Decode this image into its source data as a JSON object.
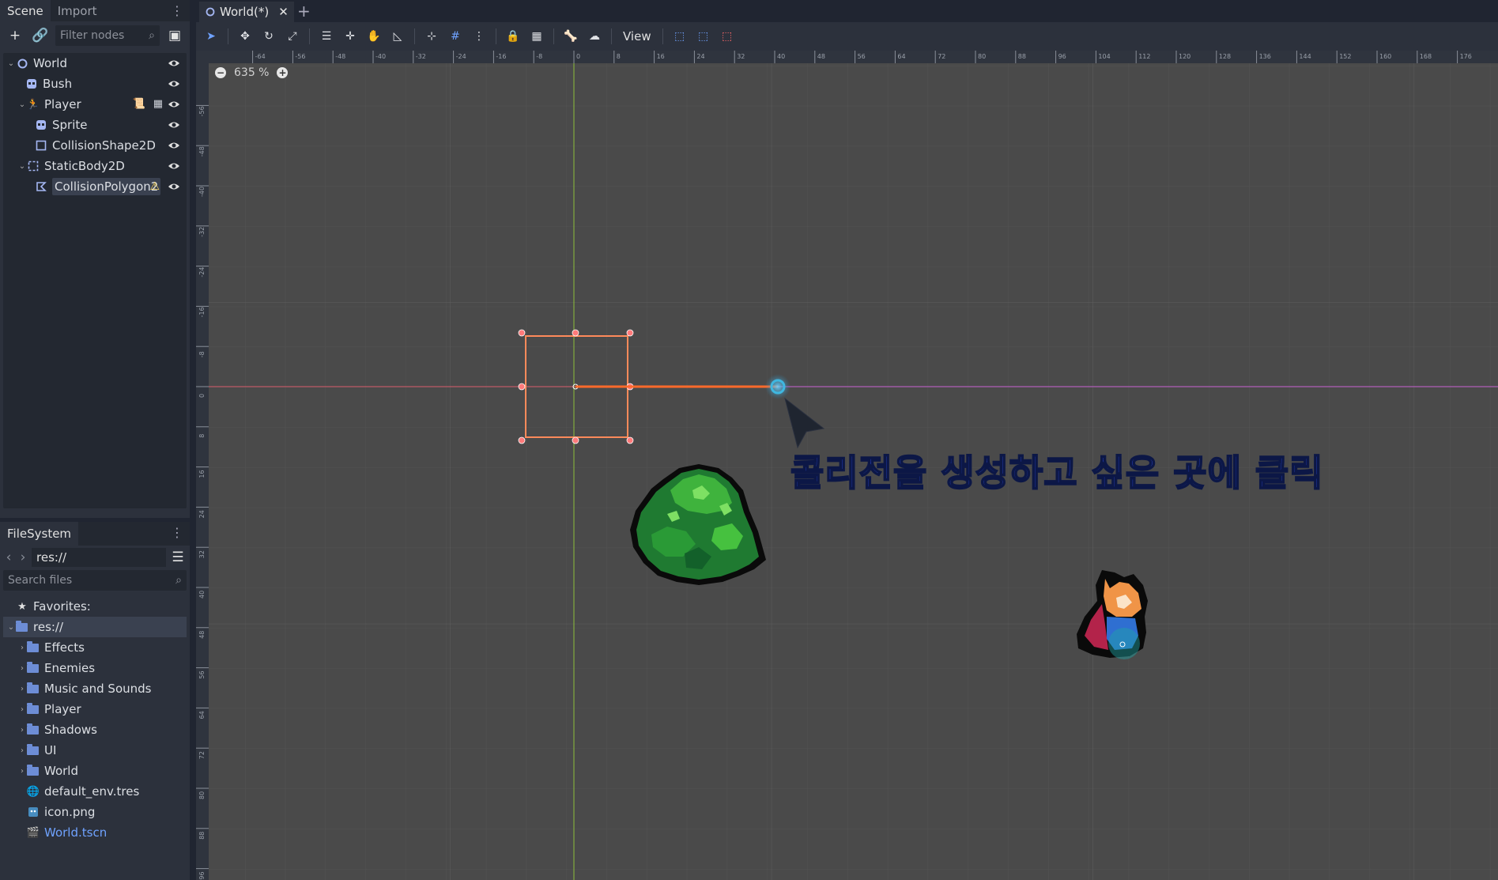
{
  "scene_dock": {
    "tabs": [
      "Scene",
      "Import"
    ],
    "filter_placeholder": "Filter nodes",
    "nodes": [
      {
        "label": "World",
        "icon": "node2d-icon"
      },
      {
        "label": "Bush",
        "icon": "sprite-icon"
      },
      {
        "label": "Player",
        "icon": "kinematic-body-icon"
      },
      {
        "label": "Sprite",
        "icon": "sprite-icon"
      },
      {
        "label": "CollisionShape2D",
        "icon": "collision-shape-icon"
      },
      {
        "label": "StaticBody2D",
        "icon": "static-body-icon"
      },
      {
        "label": "CollisionPolygon2",
        "icon": "collision-polygon-icon",
        "selected": true,
        "warning": true
      }
    ]
  },
  "filesystem": {
    "tab": "FileSystem",
    "path": "res://",
    "search_placeholder": "Search files",
    "favorites_label": "Favorites:",
    "root_label": "res://",
    "folders": [
      "Effects",
      "Enemies",
      "Music and Sounds",
      "Player",
      "Shadows",
      "UI",
      "World"
    ],
    "files": [
      {
        "label": "default_env.tres",
        "icon": "environment-icon"
      },
      {
        "label": "icon.png",
        "icon": "image-icon"
      },
      {
        "label": "World.tscn",
        "icon": "scene-file-icon",
        "highlight": true
      }
    ]
  },
  "editor": {
    "scene_tab": "World(*)",
    "view_menu": "View",
    "zoom": "635 %",
    "ruler_top": [
      "-64",
      "-56",
      "-48",
      "-40",
      "-32",
      "-24",
      "-16",
      "-8",
      "0",
      "8",
      "16",
      "24",
      "32",
      "40",
      "48",
      "56",
      "64",
      "72",
      "80",
      "88",
      "96",
      "104",
      "112",
      "120",
      "128",
      "136",
      "144",
      "152",
      "160",
      "168",
      "176"
    ],
    "ruler_left": [
      "-56",
      "-48",
      "-40",
      "-32",
      "-24",
      "-16",
      "-8",
      "0",
      "8",
      "16",
      "24",
      "32",
      "40",
      "48",
      "56",
      "64",
      "72",
      "80",
      "88",
      "96"
    ],
    "hint": "콜리전을 생성하고 싶은 곳에 클릭"
  },
  "colors": {
    "accent": "#6fa2ff",
    "polygon_outline": "#ff8a5a",
    "hint_text": "#2a45c9",
    "viewport_bg": "#4a4a4a"
  }
}
